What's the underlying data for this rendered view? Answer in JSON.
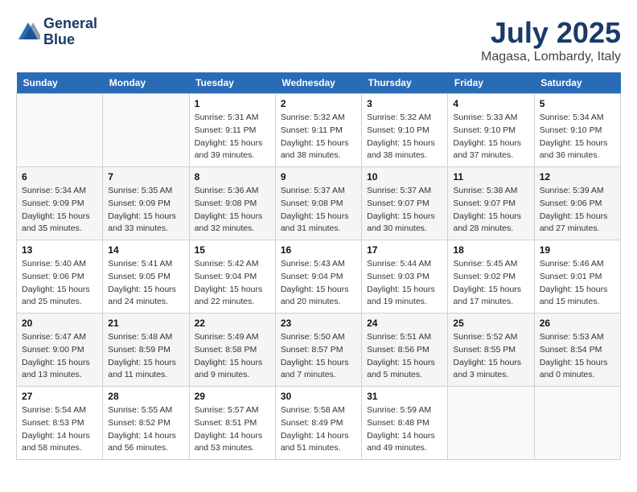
{
  "header": {
    "logo_line1": "General",
    "logo_line2": "Blue",
    "month": "July 2025",
    "location": "Magasa, Lombardy, Italy"
  },
  "weekdays": [
    "Sunday",
    "Monday",
    "Tuesday",
    "Wednesday",
    "Thursday",
    "Friday",
    "Saturday"
  ],
  "weeks": [
    [
      {
        "day": "",
        "info": ""
      },
      {
        "day": "",
        "info": ""
      },
      {
        "day": "1",
        "info": "Sunrise: 5:31 AM\nSunset: 9:11 PM\nDaylight: 15 hours and 39 minutes."
      },
      {
        "day": "2",
        "info": "Sunrise: 5:32 AM\nSunset: 9:11 PM\nDaylight: 15 hours and 38 minutes."
      },
      {
        "day": "3",
        "info": "Sunrise: 5:32 AM\nSunset: 9:10 PM\nDaylight: 15 hours and 38 minutes."
      },
      {
        "day": "4",
        "info": "Sunrise: 5:33 AM\nSunset: 9:10 PM\nDaylight: 15 hours and 37 minutes."
      },
      {
        "day": "5",
        "info": "Sunrise: 5:34 AM\nSunset: 9:10 PM\nDaylight: 15 hours and 36 minutes."
      }
    ],
    [
      {
        "day": "6",
        "info": "Sunrise: 5:34 AM\nSunset: 9:09 PM\nDaylight: 15 hours and 35 minutes."
      },
      {
        "day": "7",
        "info": "Sunrise: 5:35 AM\nSunset: 9:09 PM\nDaylight: 15 hours and 33 minutes."
      },
      {
        "day": "8",
        "info": "Sunrise: 5:36 AM\nSunset: 9:08 PM\nDaylight: 15 hours and 32 minutes."
      },
      {
        "day": "9",
        "info": "Sunrise: 5:37 AM\nSunset: 9:08 PM\nDaylight: 15 hours and 31 minutes."
      },
      {
        "day": "10",
        "info": "Sunrise: 5:37 AM\nSunset: 9:07 PM\nDaylight: 15 hours and 30 minutes."
      },
      {
        "day": "11",
        "info": "Sunrise: 5:38 AM\nSunset: 9:07 PM\nDaylight: 15 hours and 28 minutes."
      },
      {
        "day": "12",
        "info": "Sunrise: 5:39 AM\nSunset: 9:06 PM\nDaylight: 15 hours and 27 minutes."
      }
    ],
    [
      {
        "day": "13",
        "info": "Sunrise: 5:40 AM\nSunset: 9:06 PM\nDaylight: 15 hours and 25 minutes."
      },
      {
        "day": "14",
        "info": "Sunrise: 5:41 AM\nSunset: 9:05 PM\nDaylight: 15 hours and 24 minutes."
      },
      {
        "day": "15",
        "info": "Sunrise: 5:42 AM\nSunset: 9:04 PM\nDaylight: 15 hours and 22 minutes."
      },
      {
        "day": "16",
        "info": "Sunrise: 5:43 AM\nSunset: 9:04 PM\nDaylight: 15 hours and 20 minutes."
      },
      {
        "day": "17",
        "info": "Sunrise: 5:44 AM\nSunset: 9:03 PM\nDaylight: 15 hours and 19 minutes."
      },
      {
        "day": "18",
        "info": "Sunrise: 5:45 AM\nSunset: 9:02 PM\nDaylight: 15 hours and 17 minutes."
      },
      {
        "day": "19",
        "info": "Sunrise: 5:46 AM\nSunset: 9:01 PM\nDaylight: 15 hours and 15 minutes."
      }
    ],
    [
      {
        "day": "20",
        "info": "Sunrise: 5:47 AM\nSunset: 9:00 PM\nDaylight: 15 hours and 13 minutes."
      },
      {
        "day": "21",
        "info": "Sunrise: 5:48 AM\nSunset: 8:59 PM\nDaylight: 15 hours and 11 minutes."
      },
      {
        "day": "22",
        "info": "Sunrise: 5:49 AM\nSunset: 8:58 PM\nDaylight: 15 hours and 9 minutes."
      },
      {
        "day": "23",
        "info": "Sunrise: 5:50 AM\nSunset: 8:57 PM\nDaylight: 15 hours and 7 minutes."
      },
      {
        "day": "24",
        "info": "Sunrise: 5:51 AM\nSunset: 8:56 PM\nDaylight: 15 hours and 5 minutes."
      },
      {
        "day": "25",
        "info": "Sunrise: 5:52 AM\nSunset: 8:55 PM\nDaylight: 15 hours and 3 minutes."
      },
      {
        "day": "26",
        "info": "Sunrise: 5:53 AM\nSunset: 8:54 PM\nDaylight: 15 hours and 0 minutes."
      }
    ],
    [
      {
        "day": "27",
        "info": "Sunrise: 5:54 AM\nSunset: 8:53 PM\nDaylight: 14 hours and 58 minutes."
      },
      {
        "day": "28",
        "info": "Sunrise: 5:55 AM\nSunset: 8:52 PM\nDaylight: 14 hours and 56 minutes."
      },
      {
        "day": "29",
        "info": "Sunrise: 5:57 AM\nSunset: 8:51 PM\nDaylight: 14 hours and 53 minutes."
      },
      {
        "day": "30",
        "info": "Sunrise: 5:58 AM\nSunset: 8:49 PM\nDaylight: 14 hours and 51 minutes."
      },
      {
        "day": "31",
        "info": "Sunrise: 5:59 AM\nSunset: 8:48 PM\nDaylight: 14 hours and 49 minutes."
      },
      {
        "day": "",
        "info": ""
      },
      {
        "day": "",
        "info": ""
      }
    ]
  ]
}
